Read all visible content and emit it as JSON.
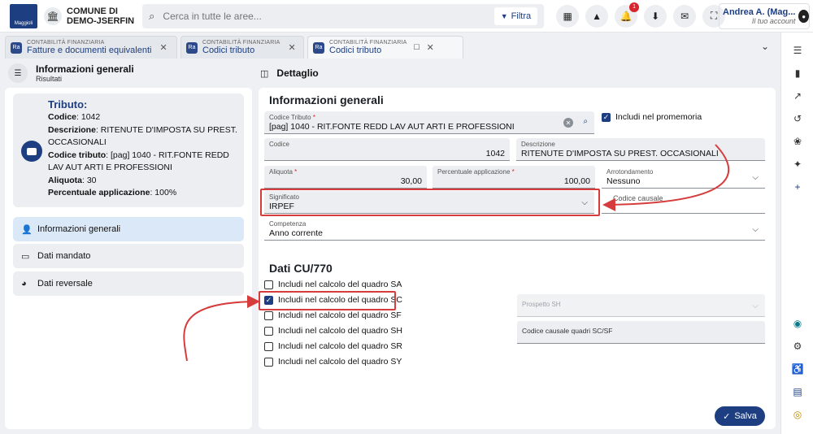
{
  "app": {
    "logo_text": "Maggioli",
    "comune_line1": "COMUNE DI",
    "comune_line2": "DEMO-JSERFIN",
    "search_placeholder": "Cerca in tutte le aree...",
    "filter_label": "Filtra",
    "notification_count": "1",
    "user_name": "Andrea A. (Mag...",
    "user_role": "Il tuo account"
  },
  "tabs": [
    {
      "subtitle": "CONTABILITÀ FINANZIARIA",
      "label": "Fatture e documenti equivalenti",
      "icon_text": "Ra"
    },
    {
      "subtitle": "CONTABILITÀ FINANZIARIA",
      "label": "Codici tributo",
      "icon_text": "Ra"
    },
    {
      "subtitle": "CONTABILITÀ FINANZIARIA",
      "label": "Codici tributo",
      "icon_text": "Ra"
    }
  ],
  "left": {
    "header_title": "Informazioni generali",
    "header_subtitle": "Risultati",
    "card": {
      "title": "Tributo:",
      "codice_label": "Codice",
      "codice_value": ": 1042",
      "descrizione_label": "Descrizione",
      "descrizione_value": ": RITENUTE D'IMPOSTA SU PREST. OCCASIONALI",
      "codice_tributo_label": "Codice tributo",
      "codice_tributo_value": ": [pag] 1040 - RIT.FONTE REDD LAV AUT ARTI E PROFESSIONI",
      "aliquota_label": "Aliquota",
      "aliquota_value": ": 30",
      "percentuale_label": "Percentuale applicazione",
      "percentuale_value": ": 100%"
    },
    "nav": [
      {
        "label": "Informazioni generali",
        "icon": "person-icon"
      },
      {
        "label": "Dati mandato",
        "icon": "card-icon"
      },
      {
        "label": "Dati reversale",
        "icon": "piggybank-icon"
      }
    ]
  },
  "right": {
    "header_title": "Dettaglio",
    "section1_title": "Informazioni generali",
    "codice_tributo": {
      "label": "Codice Tributo",
      "value": "[pag] 1040 - RIT.FONTE REDD LAV AUT ARTI E PROFESSIONI"
    },
    "includi_promemoria": "Includi nel promemoria",
    "codice": {
      "label": "Codice",
      "value": "1042"
    },
    "descrizione": {
      "label": "Descrizione",
      "value": "RITENUTE D'IMPOSTA SU PREST. OCCASIONALI"
    },
    "aliquota": {
      "label": "Aliquota",
      "value": "30,00"
    },
    "percentuale": {
      "label": "Percentuale applicazione",
      "value": "100,00"
    },
    "arrotondamento": {
      "label": "Arrotondamento",
      "value": "Nessuno"
    },
    "significato": {
      "label": "Significato",
      "value": "IRPEF"
    },
    "codice_causale": {
      "label": "Codice causale",
      "value": ""
    },
    "competenza": {
      "label": "Competenza",
      "value": "Anno corrente"
    },
    "section2_title": "Dati CU/770",
    "checkboxes": [
      {
        "label": "Includi nel calcolo del quadro SA",
        "checked": false
      },
      {
        "label": "Includi nel calcolo del quadro SC",
        "checked": true
      },
      {
        "label": "Includi nel calcolo del quadro SF",
        "checked": false
      },
      {
        "label": "Includi nel calcolo del quadro SH",
        "checked": false
      },
      {
        "label": "Includi nel calcolo del quadro SR",
        "checked": false
      },
      {
        "label": "Includi nel calcolo del quadro SY",
        "checked": false
      }
    ],
    "prospetto_sh": {
      "label": "Prospetto SH"
    },
    "codice_causale_quadri": {
      "label": "Codice causale quadri SC/SF"
    },
    "save_label": "Salva"
  },
  "colors": {
    "brand": "#1d3e80",
    "annotation": "#d63c3c",
    "notification": "#d9232d"
  }
}
